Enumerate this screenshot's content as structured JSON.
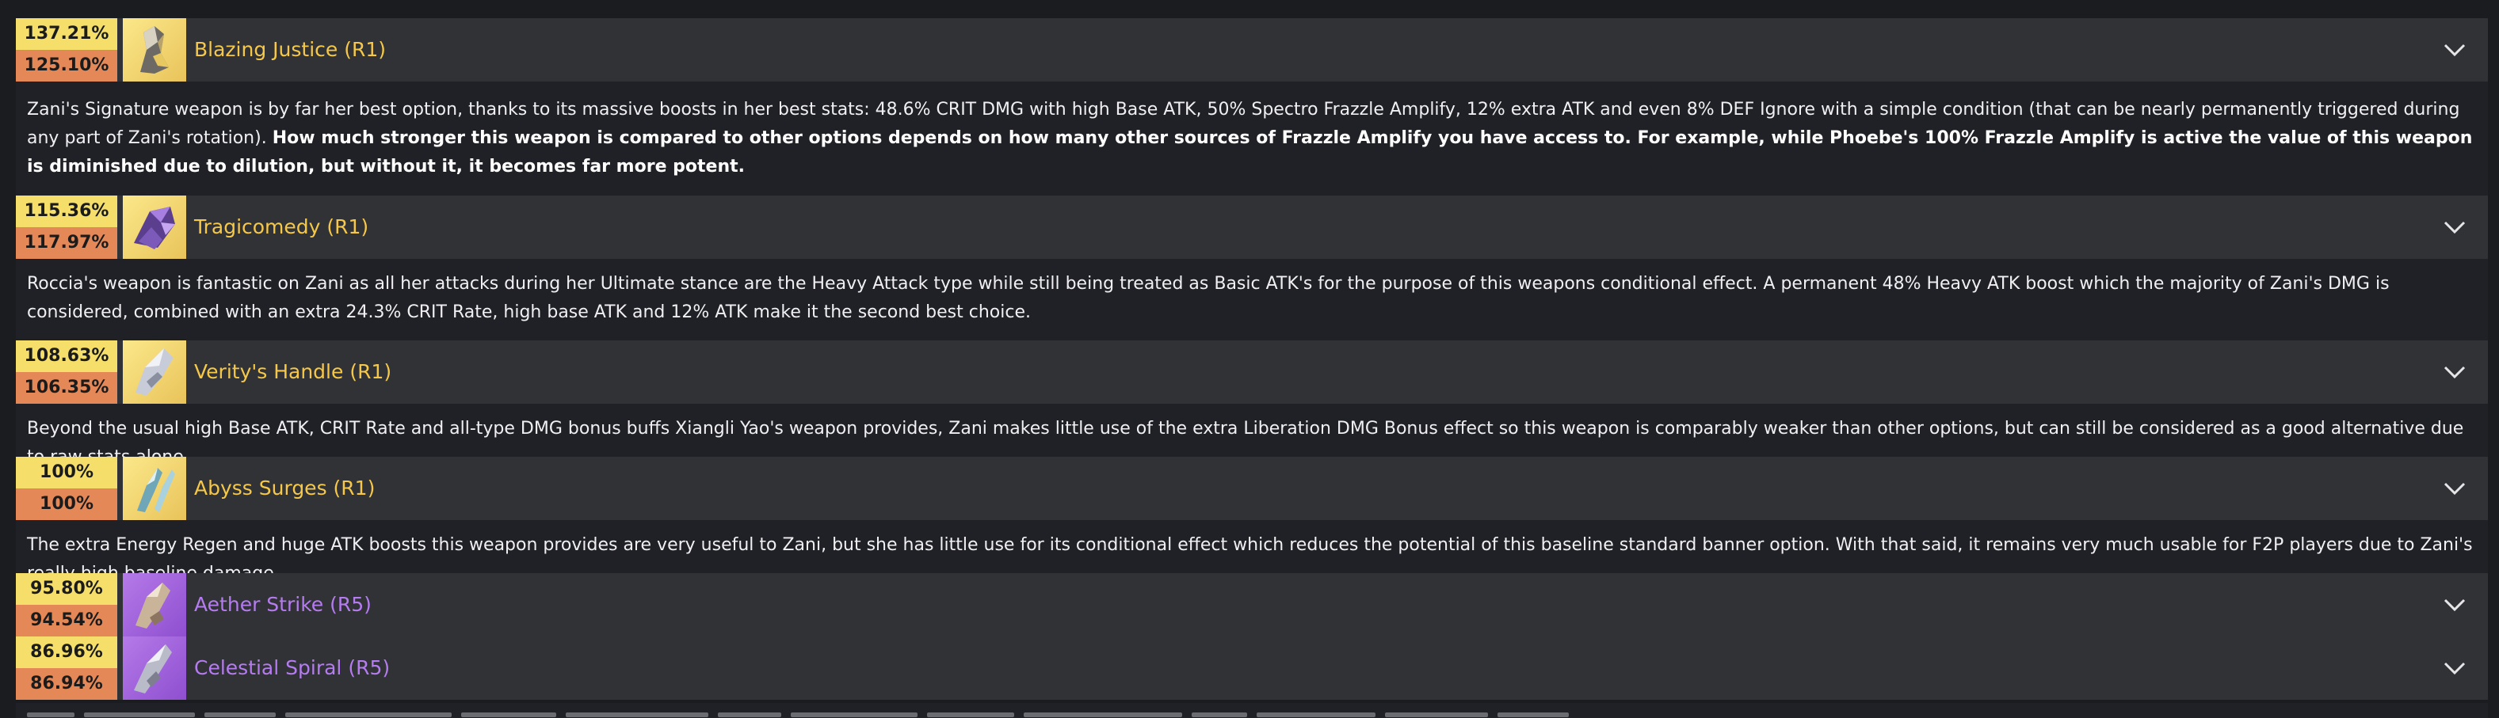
{
  "weapons": [
    {
      "name": "Blazing Justice (R1)",
      "pct_top": "137.21%",
      "pct_bottom": "125.10%",
      "rarity": "gold",
      "icon": "gauntlet-weapon-icon",
      "desc": "Zani's Signature weapon is by far her best option, thanks to its massive boosts in her best stats: 48.6% CRIT DMG with high Base ATK, 50% Spectro Frazzle Amplify, 12% extra ATK and even 8% DEF Ignore with a simple condition (that can be nearly permanently triggered during any part of Zani's rotation).",
      "desc_bold": "How much stronger this weapon is compared to other options depends on how many other sources of Frazzle Amplify you have access to. For example, while Phoebe's 100% Frazzle Amplify is active the value of this weapon is diminished due to dilution, but without it, it becomes far more potent."
    },
    {
      "name": "Tragicomedy (R1)",
      "pct_top": "115.36%",
      "pct_bottom": "117.97%",
      "rarity": "gold",
      "icon": "gauntlet-weapon-icon",
      "desc": "Roccia's weapon is fantastic on Zani as all her attacks during her Ultimate stance are the Heavy Attack type while still being treated as Basic ATK's for the purpose of this weapons conditional effect. A permanent 48% Heavy ATK boost which the majority of Zani's DMG is considered, combined with an extra 24.3% CRIT Rate, high base ATK and 12% ATK make it the second best choice."
    },
    {
      "name": "Verity's Handle (R1)",
      "pct_top": "108.63%",
      "pct_bottom": "106.35%",
      "rarity": "gold",
      "icon": "gauntlet-weapon-icon",
      "desc": "Beyond the usual high Base ATK, CRIT Rate and all-type DMG bonus buffs Xiangli Yao's weapon provides, Zani makes little use of the extra Liberation DMG Bonus effect so this weapon is comparably weaker than other options, but can still be considered as a good alternative due to raw stats alone."
    },
    {
      "name": "Abyss Surges (R1)",
      "pct_top": "100%",
      "pct_bottom": "100%",
      "rarity": "gold",
      "icon": "gauntlet-weapon-icon",
      "desc": "The extra Energy Regen and huge ATK boosts this weapon provides are very useful to Zani, but she has little use for its conditional effect which reduces the potential of this baseline standard banner option. With that said, it remains very much usable for F2P players due to Zani's really high baseline damage."
    },
    {
      "name": "Aether Strike (R5)",
      "pct_top": "95.80%",
      "pct_bottom": "94.54%",
      "rarity": "purple",
      "icon": "gauntlet-weapon-icon"
    },
    {
      "name": "Celestial Spiral (R5)",
      "pct_top": "86.96%",
      "pct_bottom": "86.94%",
      "rarity": "purple",
      "icon": "gauntlet-weapon-icon"
    }
  ],
  "colors": {
    "row_bg": "#313236",
    "desc_bg": "#202126",
    "pct_top": "#f5df6a",
    "pct_bottom": "#e58858",
    "name_gold": "#f5c84a",
    "name_purple": "#b57cf0"
  },
  "icons": {
    "expand": "chevron-down-icon"
  }
}
